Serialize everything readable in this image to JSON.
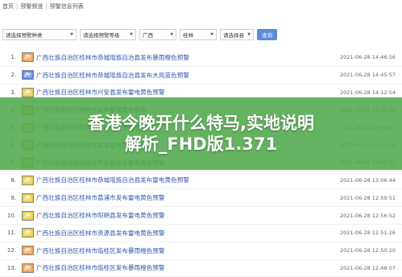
{
  "breadcrumb": {
    "items": [
      "首页",
      "预警频道",
      "预警信息列表"
    ],
    "separator": "|"
  },
  "filters": {
    "category": "请选择预警种类",
    "level": "请选择预警等级",
    "province": "广西",
    "city": "桂林",
    "district": "请选择县",
    "query_label": "查询"
  },
  "alerts": [
    {
      "index": "1.",
      "title": "广西壮族自治区桂林市恭城瑶族自治县发布暴雨橙色预警",
      "time": "2021-06-28 14:46:56",
      "icon": "rainstorm-orange-icon",
      "color": "#f08a24"
    },
    {
      "index": "2.",
      "title": "广西壮族自治区桂林市恭城瑶族自治县发布大风蓝色预警",
      "time": "2021-06-28 14:45:57",
      "icon": "wind-blue-icon",
      "color": "#3a6fd8"
    },
    {
      "index": "3.",
      "title": "广西壮族自治区桂林市兴安县发布雷电黄色预警",
      "time": "2021-06-28 14:12:54",
      "icon": "lightning-yellow-icon",
      "color": "#e8c11a"
    },
    {
      "index": "4.",
      "title": "广西壮族自治区桂林市发布雷电黄色预警",
      "time": "2021-06-28 13:40:12",
      "icon": "lightning-yellow-icon",
      "color": "#e8c11a"
    },
    {
      "index": "5.",
      "title": "广西壮族自治区桂林市发布雷电黄色预警",
      "time": "2021-06-28 13:30:45",
      "icon": "lightning-yellow-icon",
      "color": "#e8c11a"
    },
    {
      "index": "6.",
      "title": "广西壮族自治区桂林市发布雷电黄色预警",
      "time": "2021-06-28 13:21:18",
      "icon": "lightning-yellow-icon",
      "color": "#e8c11a"
    },
    {
      "index": "7.",
      "title": "广西壮族自治区桂林市平乐县发布雷电黄色预警",
      "time": "2021-06-28 13:05:33",
      "icon": "lightning-yellow-icon",
      "color": "#e8c11a"
    },
    {
      "index": "8.",
      "title": "广西壮族自治区桂林市恭城瑶族自治县发布雷电黄色预警",
      "time": "2021-06-28 13:06:44",
      "icon": "lightning-yellow-icon",
      "color": "#e8c11a"
    },
    {
      "index": "9.",
      "title": "广西壮族自治区桂林市荔浦市发布雷电黄色预警",
      "time": "2021-06-28 12:59:51",
      "icon": "lightning-yellow-icon",
      "color": "#e8c11a"
    },
    {
      "index": "10.",
      "title": "广西壮族自治区桂林市阳朔县发布雷电黄色预警",
      "time": "2021-06-28 12:56:52",
      "icon": "lightning-yellow-icon",
      "color": "#e8c11a"
    },
    {
      "index": "11.",
      "title": "广西壮族自治区桂林市资源县发布雷电黄色预警",
      "time": "2021-06-28 12:51:26",
      "icon": "lightning-yellow-icon",
      "color": "#e8c11a"
    },
    {
      "index": "12.",
      "title": "广西壮族自治区桂林市临桂区发布暴雨橙色预警",
      "time": "2021-06-28 12:50:20",
      "icon": "rainstorm-orange-icon",
      "color": "#f08a24"
    },
    {
      "index": "13.",
      "title": "广西壮族自治区桂林市临桂区发布暴雨橙色预警",
      "time": "2021-06-28 12:48:07",
      "icon": "rainstorm-orange-icon",
      "color": "#f08a24"
    }
  ],
  "overlay": {
    "line1": "香港今晚开什么特马,实地说明",
    "line2": "解析_FHD版1.371",
    "color": "#4fa84a"
  }
}
